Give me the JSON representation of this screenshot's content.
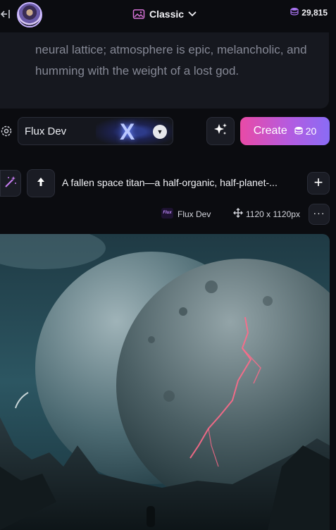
{
  "header": {
    "mode_label": "Classic",
    "credits": "29,815",
    "collapse_icon": "collapse-left-icon",
    "mode_icon": "image-icon",
    "credits_icon": "coins-icon"
  },
  "prompt": {
    "text": "neural lattice; atmosphere is epic, melancholic, and humming with the weight of a lost god."
  },
  "controls": {
    "model_name": "Flux Dev",
    "create_label": "Create",
    "create_cost": "20"
  },
  "generation": {
    "title": "A fallen space titan—a half-organic, half-planet-...",
    "model": "Flux Dev",
    "model_badge": "Flux",
    "size": "1120 x 1120px"
  },
  "colors": {
    "accent_start": "#e94aa6",
    "accent_end": "#8a6cf5",
    "background": "#0b0c10",
    "card": "#16181f"
  }
}
